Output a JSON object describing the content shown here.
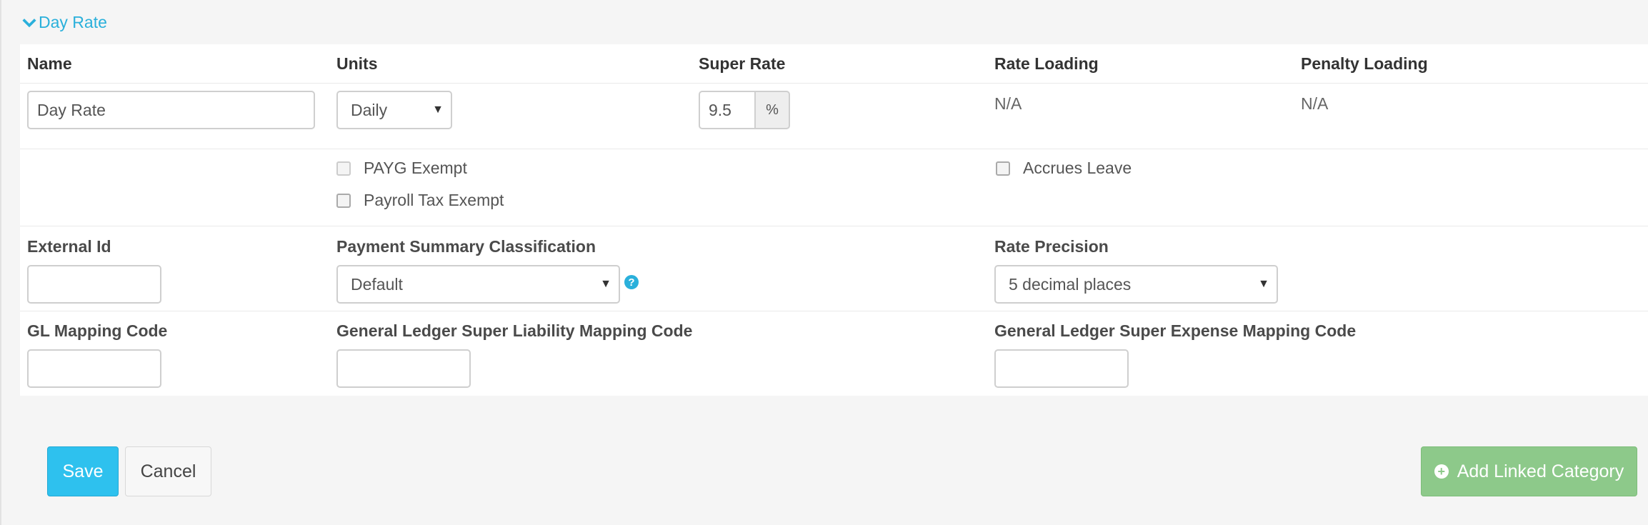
{
  "section": {
    "title": "Day Rate",
    "toggle_icon": "chevron-down-icon"
  },
  "header_row": {
    "name": "Name",
    "units": "Units",
    "super_rate": "Super Rate",
    "rate_loading": "Rate Loading",
    "penalty_loading": "Penalty Loading"
  },
  "values_row": {
    "name_value": "Day Rate",
    "units_selected": "Daily",
    "super_rate_value": "9.5",
    "super_rate_addon": "%",
    "rate_loading_value": "N/A",
    "penalty_loading_value": "N/A"
  },
  "checkboxes": {
    "payg_exempt": "PAYG Exempt",
    "payroll_tax_exempt": "Payroll Tax Exempt",
    "accrues_leave": "Accrues Leave"
  },
  "fields_row_1": {
    "external_id_label": "External Id",
    "external_id_value": "",
    "payment_summary_label": "Payment Summary Classification",
    "payment_summary_selected": "Default",
    "rate_precision_label": "Rate Precision",
    "rate_precision_selected": "5 decimal places"
  },
  "fields_row_2": {
    "gl_mapping_label": "GL Mapping Code",
    "gl_super_liability_label": "General Ledger Super Liability Mapping Code",
    "gl_super_expense_label": "General Ledger Super Expense Mapping Code"
  },
  "actions": {
    "save": "Save",
    "cancel": "Cancel",
    "add_linked_category": "Add Linked Category"
  },
  "colors": {
    "accent": "#2ab0db",
    "save_button": "#2ec1ee",
    "add_button": "#8dc98a"
  }
}
